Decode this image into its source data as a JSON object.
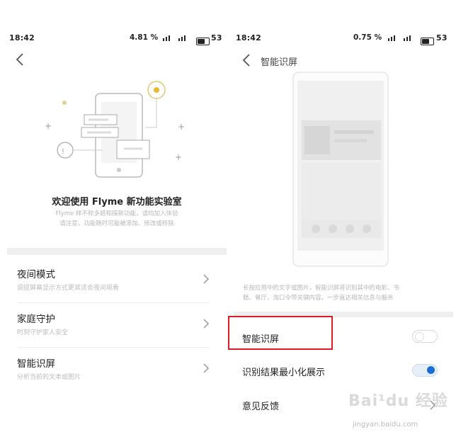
{
  "left": {
    "status": {
      "time": "18:42",
      "net": "4.81",
      "net_unit": "%",
      "carrier": "‡ıl ‡ıl",
      "battery": "53"
    },
    "back_icon": "chevron-left-icon",
    "headline": "欢迎使用 Flyme 新功能实验室",
    "desc_line1": "Flyme 样不称多姬和探新功能，请均加入体验",
    "desc_line2": "请注意，功能随时可能被添加、修改或移除",
    "items": [
      {
        "title": "夜间模式",
        "sub": "调提屏幕显示方式更其适合夜间观看"
      },
      {
        "title": "家庭守护",
        "sub": "时刻守护家人安全"
      },
      {
        "title": "智能识屏",
        "sub": "分析当前的文本或图片"
      }
    ]
  },
  "right": {
    "status": {
      "time": "18:42",
      "net": "0.75",
      "net_unit": "%",
      "battery": "53"
    },
    "page_title": "智能识屏",
    "desc_line1": "长按应用中的文字或图片，智能识屏将识别其中的电影、书",
    "desc_line2": "籍、餐厅、淘口令带关键内容，一步直达相关信息与服务",
    "settings": [
      {
        "label": "智能识屏",
        "state": "off"
      },
      {
        "label": "识别结果最小化展示",
        "state": "on"
      },
      {
        "label": "意见反馈"
      }
    ],
    "watermark": "Bai¹du 经验",
    "watermark_sub": "jingyan.baidu.com",
    "accent": "#1a6fd0",
    "highlight": "#d81e2a"
  }
}
